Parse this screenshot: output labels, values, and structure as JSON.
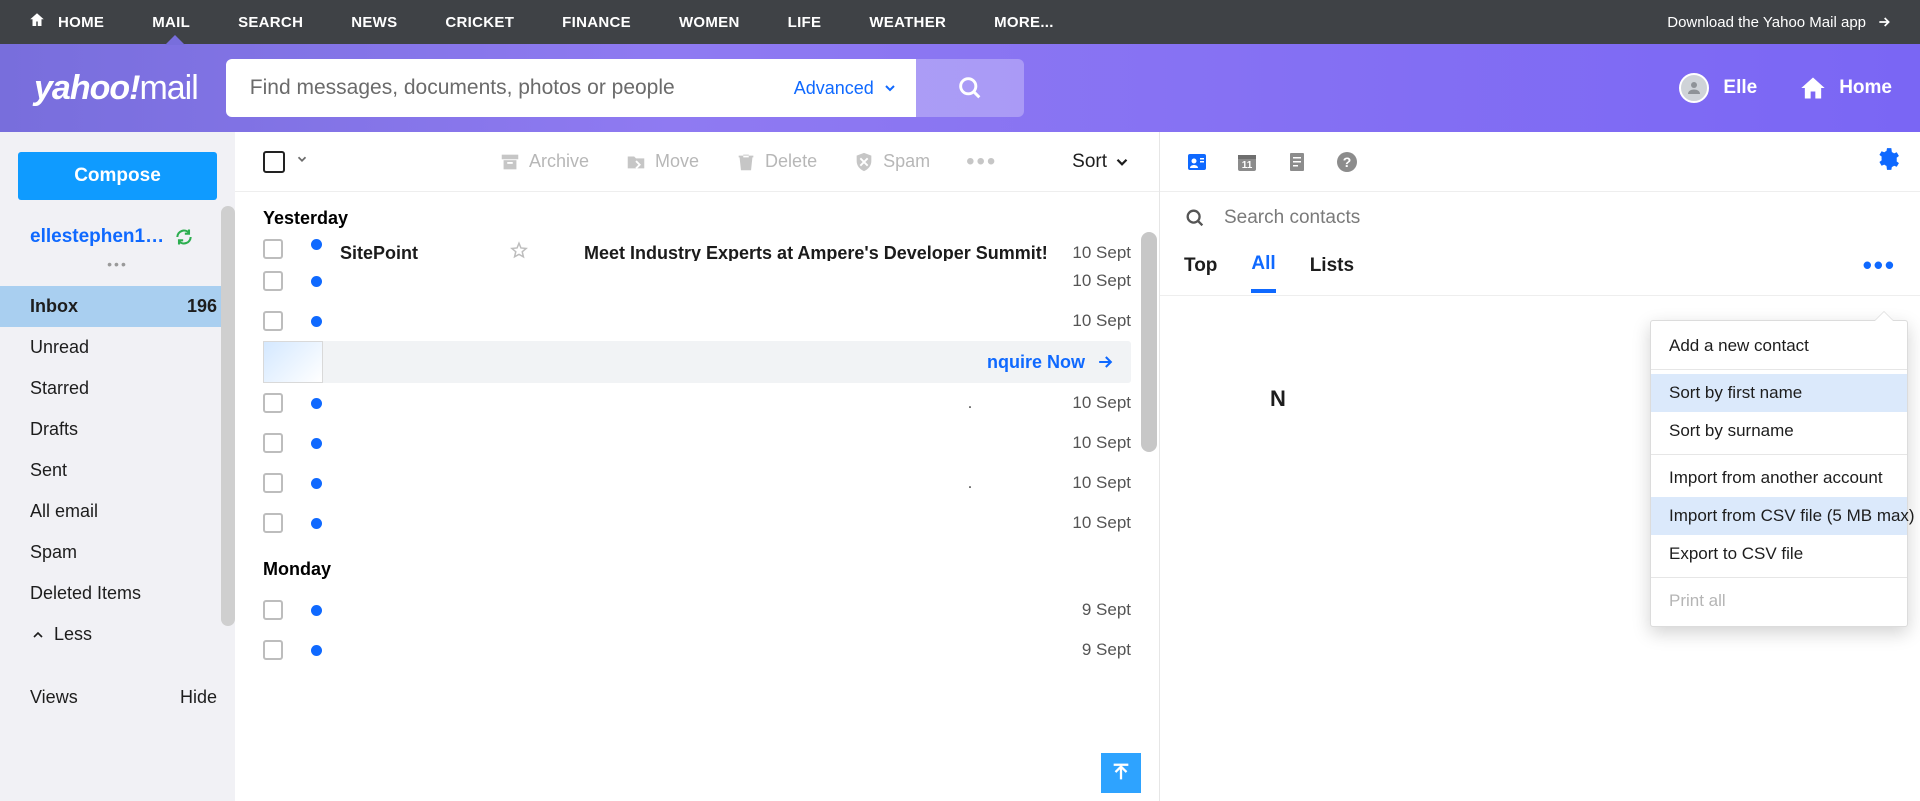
{
  "topnav": {
    "items": [
      "HOME",
      "MAIL",
      "SEARCH",
      "NEWS",
      "CRICKET",
      "FINANCE",
      "WOMEN",
      "LIFE",
      "WEATHER",
      "MORE..."
    ],
    "download": "Download the Yahoo Mail app"
  },
  "header": {
    "logo_brand": "yahoo!",
    "logo_product": "mail",
    "search_placeholder": "Find messages, documents, photos or people",
    "advanced": "Advanced",
    "user_name": "Elle",
    "home_label": "Home"
  },
  "sidebar": {
    "compose": "Compose",
    "account": "ellestephen1…",
    "folders": [
      {
        "label": "Inbox",
        "count": "196",
        "active": true
      },
      {
        "label": "Unread"
      },
      {
        "label": "Starred"
      },
      {
        "label": "Drafts"
      },
      {
        "label": "Sent"
      },
      {
        "label": "All email"
      },
      {
        "label": "Spam"
      },
      {
        "label": "Deleted Items"
      }
    ],
    "less": "Less",
    "views": "Views",
    "hide": "Hide"
  },
  "toolbar": {
    "archive": "Archive",
    "move": "Move",
    "delete": "Delete",
    "spam": "Spam",
    "sort": "Sort"
  },
  "messages": {
    "group1": "Yesterday",
    "group2": "Monday",
    "rows": [
      {
        "sender": "SitePoint",
        "subject": "Meet Industry Experts at Ampere's Developer Summit!",
        "date": "10 Sept",
        "peek": true
      },
      {
        "date": "10 Sept"
      },
      {
        "date": "10 Sept"
      },
      {
        "ad": true,
        "cta": "nquire Now"
      },
      {
        "date": "10 Sept",
        "dot": true
      },
      {
        "date": "10 Sept"
      },
      {
        "date": "10 Sept",
        "dot": true
      },
      {
        "date": "10 Sept"
      }
    ],
    "rows2": [
      {
        "date": "9 Sept"
      },
      {
        "date": "9 Sept"
      }
    ]
  },
  "contacts": {
    "search_placeholder": "Search contacts",
    "tabs": [
      "Top",
      "All",
      "Lists"
    ],
    "body_stub": "N",
    "menu": {
      "add": "Add a new contact",
      "sort_first": "Sort by first name",
      "sort_last": "Sort by surname",
      "import_acct": "Import from another account",
      "import_csv": "Import from CSV file (5 MB max)",
      "export_csv": "Export to CSV file",
      "print": "Print all"
    }
  }
}
